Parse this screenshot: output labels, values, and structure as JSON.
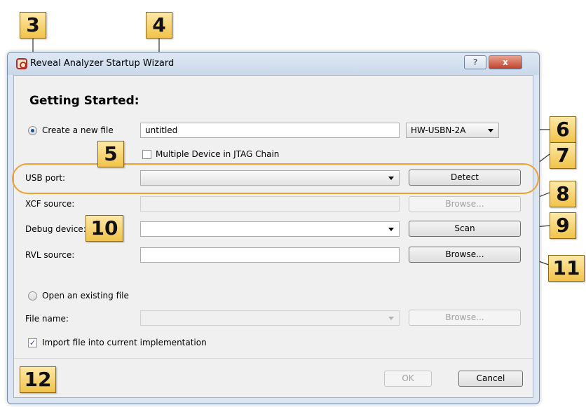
{
  "window": {
    "title": "Reveal Analyzer Startup Wizard",
    "help_label": "?",
    "close_label": "x"
  },
  "heading": "Getting Started:",
  "create": {
    "radio_label": "Create a new file",
    "file_value": "untitled",
    "cable_value": "HW-USBN-2A",
    "multi_device_label": "Multiple Device in JTAG Chain"
  },
  "usb": {
    "label": "USB port:",
    "value": "",
    "detect_label": "Detect"
  },
  "xcf": {
    "label": "XCF source:",
    "value": "",
    "browse_label": "Browse..."
  },
  "debug": {
    "label": "Debug device:",
    "value": "",
    "scan_label": "Scan"
  },
  "rvl": {
    "label": "RVL source:",
    "value": "",
    "browse_label": "Browse..."
  },
  "open": {
    "radio_label": "Open an existing file",
    "file_label": "File name:",
    "file_value": "",
    "browse_label": "Browse..."
  },
  "import_label": "Import file into current implementation",
  "footer": {
    "ok_label": "OK",
    "cancel_label": "Cancel"
  },
  "callouts": {
    "c3": "3",
    "c4": "4",
    "c5": "5",
    "c6": "6",
    "c7": "7",
    "c8": "8",
    "c9": "9",
    "c10": "10",
    "c11": "11",
    "c12": "12"
  },
  "colors": {
    "callout": "#f1c349",
    "highlight": "#f0a030",
    "window": "#dce6f2"
  }
}
